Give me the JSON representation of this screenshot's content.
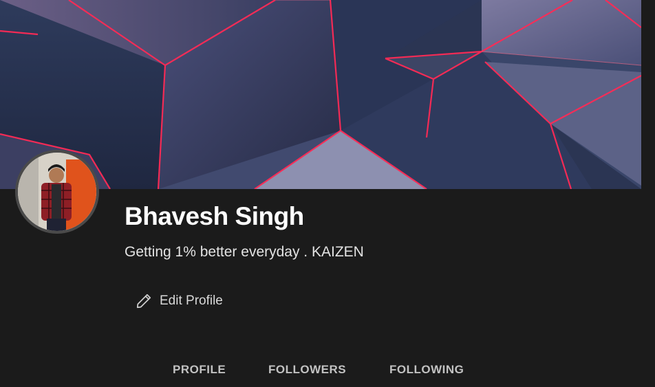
{
  "profile": {
    "name": "Bhavesh Singh",
    "bio": "Getting 1% better everyday . KAIZEN"
  },
  "actions": {
    "edit_label": "Edit Profile",
    "edit_icon": "pencil-icon"
  },
  "tabs": [
    {
      "label": "PROFILE"
    },
    {
      "label": "FOLLOWERS"
    },
    {
      "label": "FOLLOWING"
    }
  ],
  "colors": {
    "background": "#1b1b1b",
    "cover_accent": "#ff2a55",
    "text_primary": "#ffffff",
    "text_secondary": "#e3e3e3",
    "tab_text": "#c2c2c2"
  }
}
